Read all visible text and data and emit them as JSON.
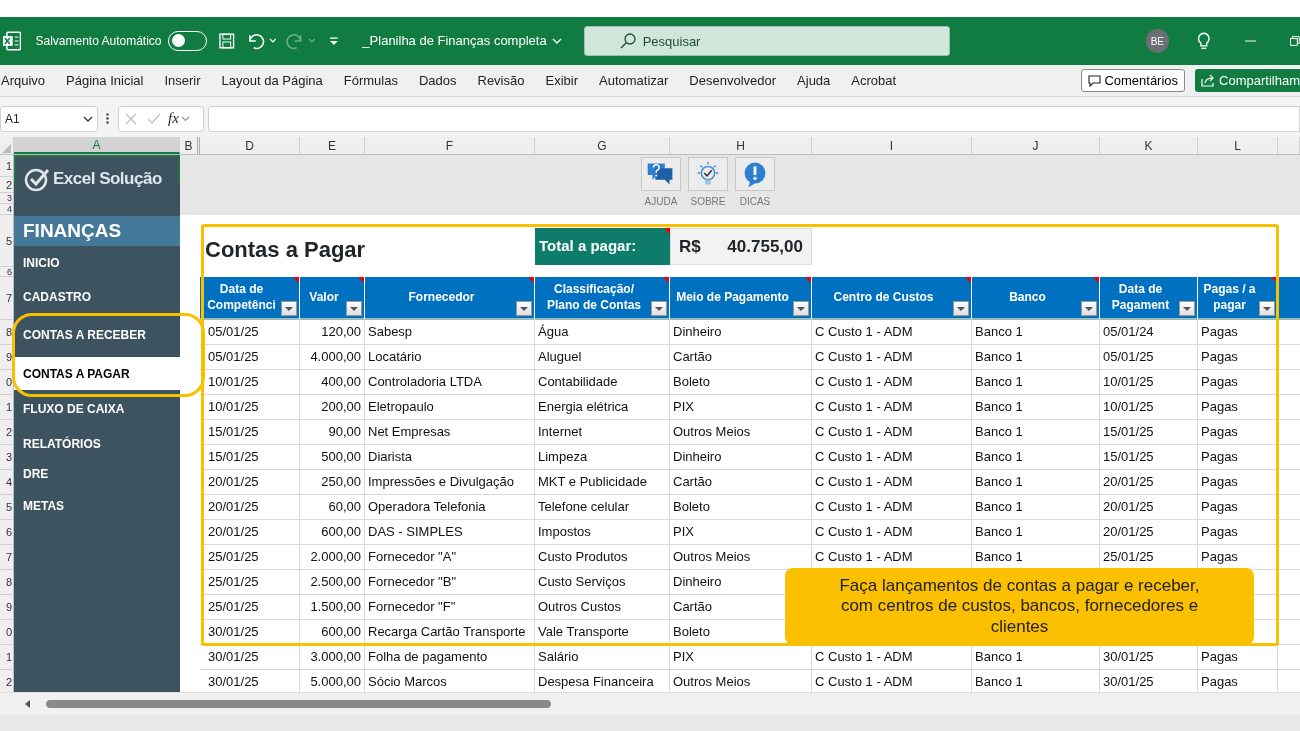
{
  "title_bar": {
    "autosave_label": "Salvamento Automático",
    "autosave_on": false,
    "file_name": "_Planilha de Finanças completa",
    "search_placeholder": "Pesquisar",
    "avatar": "BE"
  },
  "ribbon_tabs": [
    {
      "label": "Arquivo"
    },
    {
      "label": "Página Inicial"
    },
    {
      "label": "Inserir"
    },
    {
      "label": "Layout da Página"
    },
    {
      "label": "Fórmulas"
    },
    {
      "label": "Dados"
    },
    {
      "label": "Revisão"
    },
    {
      "label": "Exibir"
    },
    {
      "label": "Automatizar"
    },
    {
      "label": "Desenvolvedor"
    },
    {
      "label": "Ajuda"
    },
    {
      "label": "Acrobat"
    }
  ],
  "ribbon_buttons": {
    "comments": "Comentários",
    "share": "Compartilham"
  },
  "formula_bar": {
    "name_box": "A1",
    "fx": "fx"
  },
  "column_headers": [
    {
      "label": "A",
      "selected": true
    },
    {
      "label": "B",
      "selected": false
    },
    {
      "label": "D",
      "selected": false
    },
    {
      "label": "E",
      "selected": false
    },
    {
      "label": "F",
      "selected": false
    },
    {
      "label": "G",
      "selected": false
    },
    {
      "label": "H",
      "selected": false
    },
    {
      "label": "I",
      "selected": false
    },
    {
      "label": "J",
      "selected": false
    },
    {
      "label": "K",
      "selected": false
    },
    {
      "label": "L",
      "selected": false
    }
  ],
  "row_numbers": [
    "1",
    "2",
    "3",
    "4",
    "5",
    "6",
    "7",
    "8",
    "9",
    "0",
    "1",
    "2",
    "3",
    "4",
    "5",
    "6",
    "7",
    "8",
    "9",
    "0",
    "1",
    "2"
  ],
  "sidebar": {
    "logo_text": "Excel Solução",
    "section": "FINANÇAS",
    "items": [
      {
        "label": "INICIO",
        "selected": false
      },
      {
        "label": "CADASTRO",
        "selected": false
      },
      {
        "label": "CONTAS A RECEBER",
        "selected": false
      },
      {
        "label": "CONTAS A PAGAR",
        "selected": true
      },
      {
        "label": "FLUXO DE CAIXA",
        "selected": false
      },
      {
        "label": "RELATÓRIOS",
        "selected": false
      },
      {
        "label": "DRE",
        "selected": false
      },
      {
        "label": "METAS",
        "selected": false
      }
    ]
  },
  "toolbar_buttons": [
    {
      "label": "AJUDA",
      "kind": "help"
    },
    {
      "label": "SOBRE",
      "kind": "about"
    },
    {
      "label": "DICAS",
      "kind": "tips"
    }
  ],
  "sheet": {
    "title": "Contas a Pagar",
    "total_label": "Total a pagar:",
    "total_currency": "R$",
    "total_value": "40.755,00",
    "columns": [
      {
        "label": "Data de Competênci",
        "numeric": false,
        "comment": true
      },
      {
        "label": "Valor",
        "numeric": true,
        "comment": true
      },
      {
        "label": "Fornecedor",
        "numeric": false,
        "comment": true
      },
      {
        "label": "Classificação/ Plano de Contas",
        "numeric": false,
        "comment": true
      },
      {
        "label": "Meio de Pagamento",
        "numeric": false,
        "comment": true
      },
      {
        "label": "Centro de Custos",
        "numeric": false,
        "comment": true
      },
      {
        "label": "Banco",
        "numeric": false,
        "comment": true
      },
      {
        "label": "Data de Pagament",
        "numeric": false,
        "comment": false
      },
      {
        "label": "Pagas / a pagar",
        "numeric": false,
        "comment": true
      }
    ],
    "rows": [
      [
        "05/01/25",
        "120,00",
        "Sabesp",
        "Água",
        "Dinheiro",
        "C Custo 1 - ADM",
        "Banco 1",
        "05/01/24",
        "Pagas"
      ],
      [
        "05/01/25",
        "4.000,00",
        "Locatário",
        "Aluguel",
        "Cartão",
        "C Custo 1 - ADM",
        "Banco 1",
        "05/01/25",
        "Pagas"
      ],
      [
        "10/01/25",
        "400,00",
        "Controladoria LTDA",
        "Contabilidade",
        "Boleto",
        "C Custo 1 - ADM",
        "Banco 1",
        "10/01/25",
        "Pagas"
      ],
      [
        "10/01/25",
        "200,00",
        "Eletropaulo",
        "Energia elétrica",
        "PIX",
        "C Custo 1 - ADM",
        "Banco 1",
        "10/01/25",
        "Pagas"
      ],
      [
        "15/01/25",
        "90,00",
        "Net Empresas",
        "Internet",
        "Outros Meios",
        "C Custo 1 - ADM",
        "Banco 1",
        "15/01/25",
        "Pagas"
      ],
      [
        "15/01/25",
        "500,00",
        "Diarista",
        "Limpeza",
        "Dinheiro",
        "C Custo 1 - ADM",
        "Banco 1",
        "15/01/25",
        "Pagas"
      ],
      [
        "20/01/25",
        "250,00",
        "Impressões e Divulgação",
        "MKT e Publicidade",
        "Cartão",
        "C Custo 1 - ADM",
        "Banco 1",
        "20/01/25",
        "Pagas"
      ],
      [
        "20/01/25",
        "60,00",
        "Operadora Telefonia",
        "Telefone celular",
        "Boleto",
        "C Custo 1 - ADM",
        "Banco 1",
        "20/01/25",
        "Pagas"
      ],
      [
        "20/01/25",
        "600,00",
        "DAS - SIMPLES",
        "Impostos",
        "PIX",
        "C Custo 1 - ADM",
        "Banco 1",
        "20/01/25",
        "Pagas"
      ],
      [
        "25/01/25",
        "2.000,00",
        "Fornecedor \"A\"",
        "Custo Produtos",
        "Outros Meios",
        "C Custo 1 - ADM",
        "Banco 1",
        "25/01/25",
        "Pagas"
      ],
      [
        "25/01/25",
        "2.500,00",
        "Fornecedor \"B\"",
        "Custo Serviços",
        "Dinheiro",
        null,
        null,
        null,
        null
      ],
      [
        "25/01/25",
        "1.500,00",
        "Fornecedor \"F\"",
        "Outros Custos",
        "Cartão",
        null,
        null,
        null,
        null
      ],
      [
        "30/01/25",
        "600,00",
        "Recarga Cartão Transporte",
        "Vale Transporte",
        "Boleto",
        null,
        null,
        null,
        null
      ],
      [
        "30/01/25",
        "3.000,00",
        "Folha de pagamento",
        "Salário",
        "PIX",
        "C Custo 1 - ADM",
        "Banco 1",
        "30/01/25",
        "Pagas"
      ],
      [
        "30/01/25",
        "5.000,00",
        "Sócio Marcos",
        "Despesa Financeira",
        "Outros Meios",
        "C Custo 1 - ADM",
        "Banco 1",
        "30/01/25",
        "Pagas"
      ]
    ]
  },
  "callout": "Faça lançamentos de contas a pagar e receber, com centros de custos, bancos, fornecedores e clientes"
}
